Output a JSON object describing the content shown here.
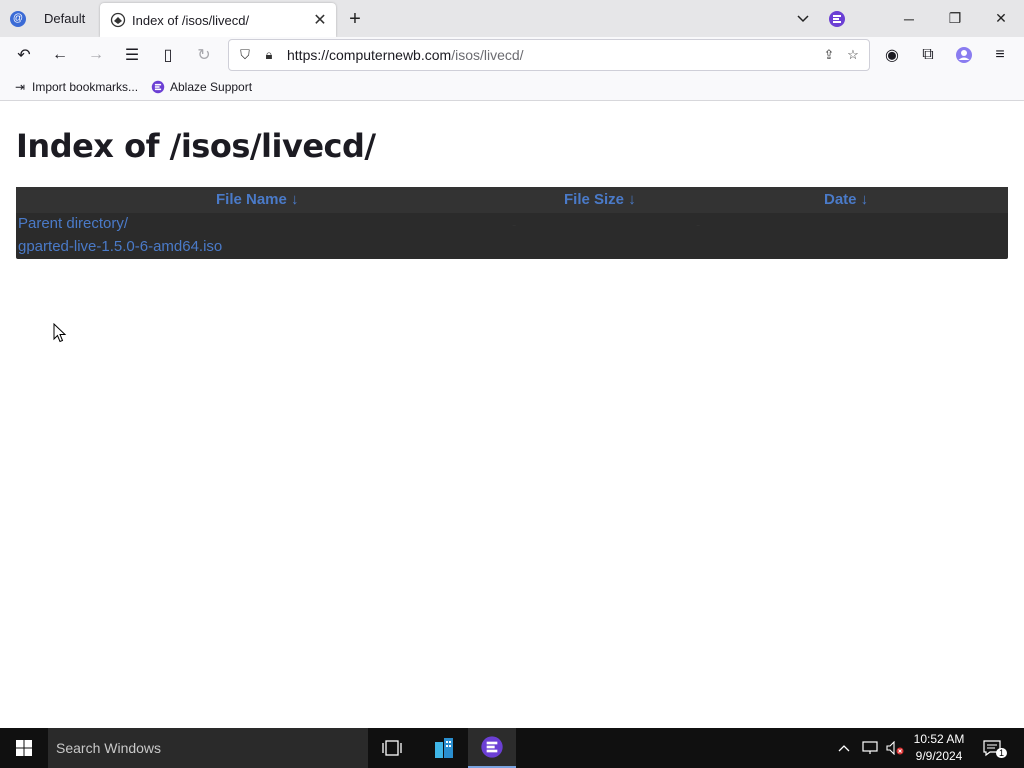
{
  "browser": {
    "profile_label": "Default",
    "tab_title": "Index of /isos/livecd/",
    "url_host": "https://computernewb.com",
    "url_path": "/isos/livecd/",
    "bookmarks": [
      "Import bookmarks...",
      "Ablaze Support"
    ]
  },
  "page": {
    "heading": "Index of /isos/livecd/",
    "columns": [
      "File Name  ↓",
      "File Size  ↓",
      "Date  ↓"
    ],
    "rows": [
      {
        "name": "Parent directory/",
        "size": "-",
        "date": "-"
      },
      {
        "name": "gparted-live-1.5.0-6-amd64.iso",
        "size": "",
        "date": ""
      }
    ]
  },
  "taskbar": {
    "search_placeholder": "Search Windows",
    "time": "10:52 AM",
    "date": "9/9/2024",
    "notification_count": "1"
  },
  "colors": {
    "link": "#4a7ac8",
    "table_bg": "#2b2b2b",
    "table_header_bg": "#333333"
  }
}
